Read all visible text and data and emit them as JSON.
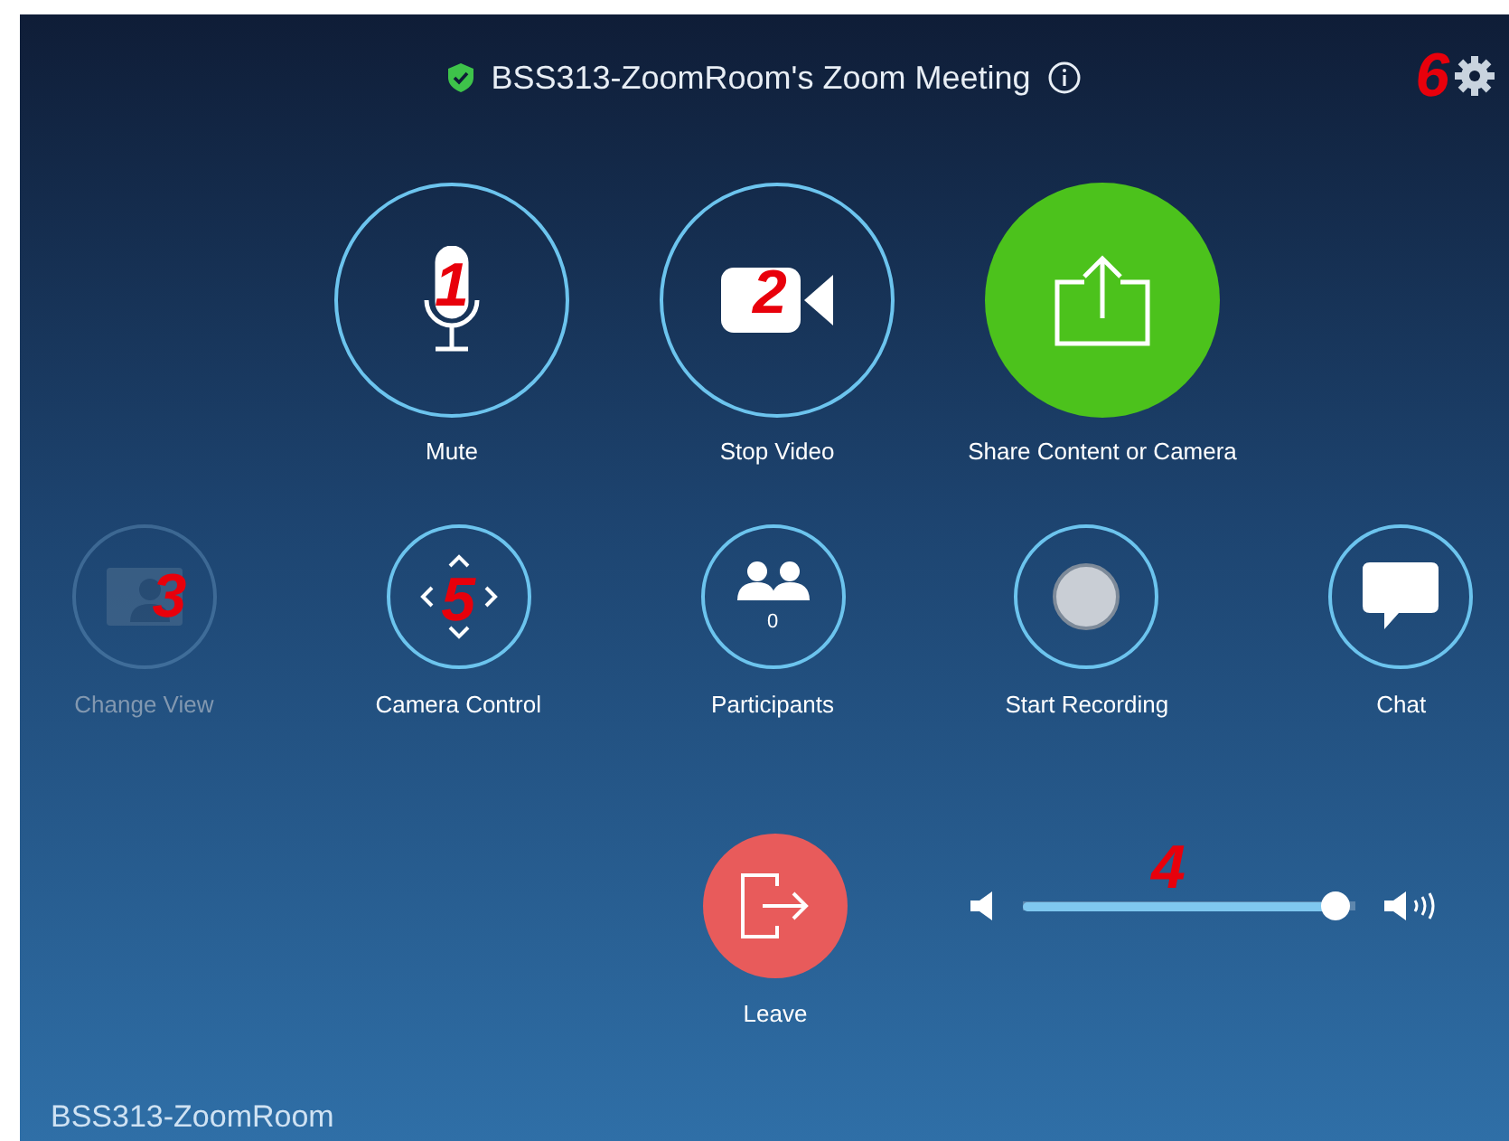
{
  "title": {
    "text": "BSS313-ZoomRoom's Zoom Meeting"
  },
  "settings": {
    "callout": "6"
  },
  "primary_controls": [
    {
      "kind": "mic",
      "label": "Mute",
      "callout": "1"
    },
    {
      "kind": "video",
      "label": "Stop Video",
      "callout": "2"
    },
    {
      "kind": "share",
      "label": "Share Content or Camera"
    }
  ],
  "secondary_controls": [
    {
      "kind": "view",
      "label": "Change View",
      "disabled": true,
      "callout": "3"
    },
    {
      "kind": "camera",
      "label": "Camera Control",
      "disabled": false,
      "callout": "5"
    },
    {
      "kind": "participants",
      "label": "Participants",
      "count": "0",
      "disabled": false
    },
    {
      "kind": "record",
      "label": "Start Recording",
      "disabled": false
    },
    {
      "kind": "chat",
      "label": "Chat",
      "disabled": false
    }
  ],
  "leave": {
    "label": "Leave"
  },
  "volume": {
    "level": 0.98,
    "callout": "4"
  },
  "room_name": "BSS313-ZoomRoom"
}
